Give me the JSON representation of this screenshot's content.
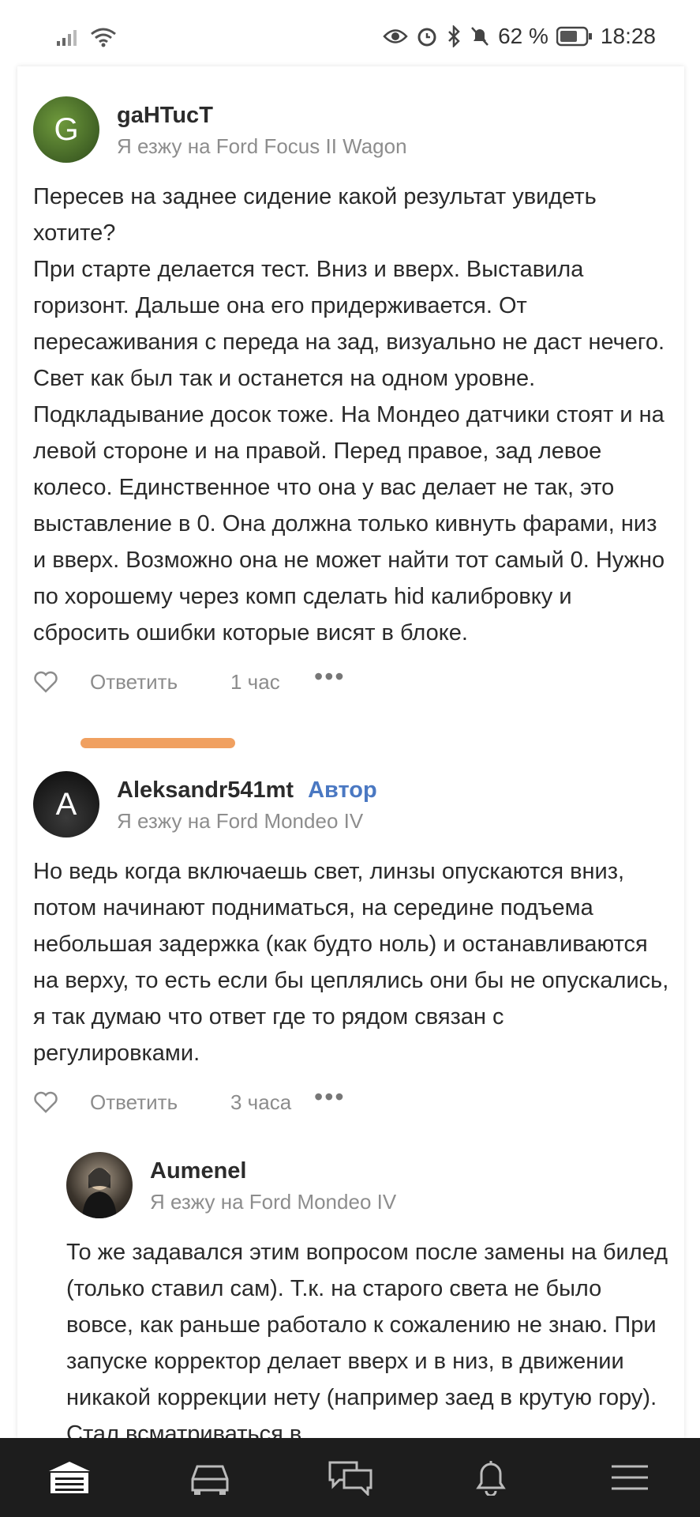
{
  "status_bar": {
    "battery": "62 %",
    "time": "18:28"
  },
  "comments": [
    {
      "avatar_letter": "G",
      "username": "gaHTucT",
      "subline": "Я езжу на Ford Focus II Wagon",
      "text": "Пересев на заднее сидение какой результат увидеть хотите?\nПри старте делается тест. Вниз и вверх. Выставила горизонт. Дальше она его придерживается. От пересаживания с переда на зад, визуально не даст нечего. Свет как был так и останется на одном уровне. Подкладывание досок тоже. На Мондео датчики стоят и на левой стороне и на правой. Перед правое, зад левое колесо. Единственное что она у вас делает не так, это выставление в 0. Она должна только кивнуть фарами, низ и вверх. Возможно она не может найти тот самый 0. Нужно по хорошему через комп сделать hid калибровку и сбросить ошибки которые висят в блоке.",
      "reply": "Ответить",
      "time": "1 час"
    },
    {
      "avatar_letter": "A",
      "username": "Aleksandr541mt",
      "badge": "Автор",
      "subline": "Я езжу на Ford Mondeo IV",
      "text": "Но ведь когда включаешь свет, линзы опускаются вниз, потом начинают подниматься, на середине подъема небольшая задержка (как будто ноль) и останавливаются на верху, то есть если бы цеплялись они бы не опускались, я так думаю что ответ где то рядом связан с регулировками.",
      "reply": "Ответить",
      "time": "3 часа"
    },
    {
      "username": "Aumenel",
      "subline": "Я езжу на Ford Mondeo IV",
      "text": "То же задавался этим вопросом после замены на билед (только ставил сам). Т.к. на старого света не было вовсе, как раньше работало к сожалению не знаю. При запуске корректор делает вверх и в низ, в движении никакой коррекции нету (например заед в крутую гору). Стал всматриваться в"
    }
  ],
  "colors": {
    "author": "#4a78c2",
    "highlight": "#f0a060",
    "nav_bg": "#1d1d1d"
  },
  "bottom_nav": [
    "home-icon",
    "car-icon",
    "messages-icon",
    "bell-icon",
    "menu-icon"
  ]
}
